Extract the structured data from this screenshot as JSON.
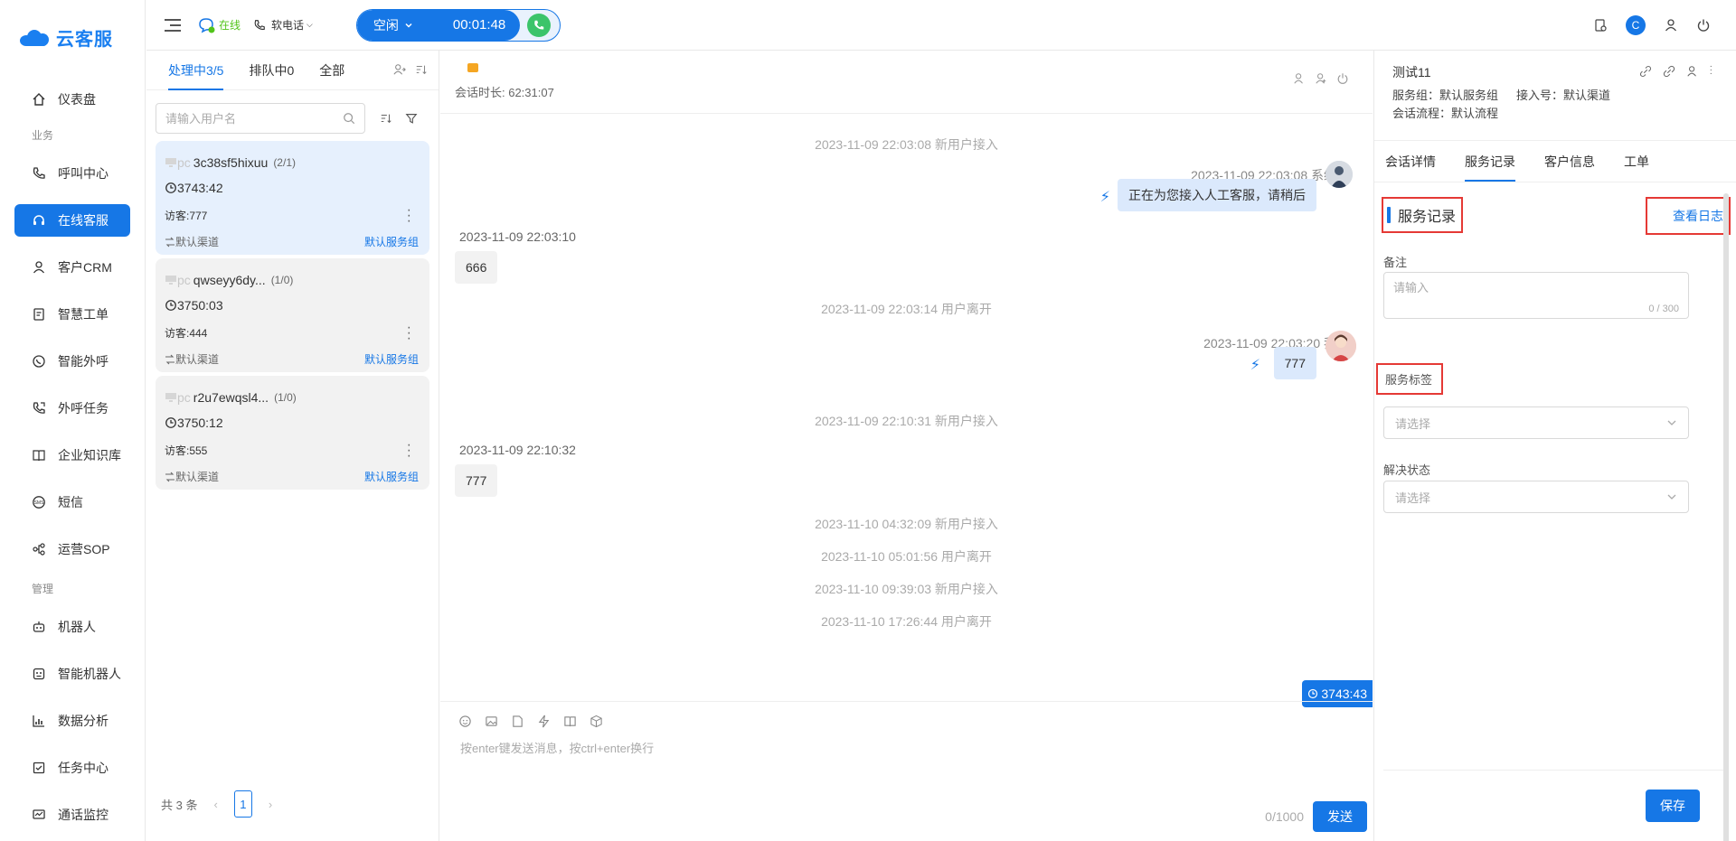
{
  "app": {
    "logo_text": "云客服",
    "brand_color": "#1677e6"
  },
  "sidebar": {
    "items": [
      {
        "label": "仪表盘",
        "icon": "home-icon"
      },
      {
        "group": "业务"
      },
      {
        "label": "呼叫中心",
        "icon": "phone-icon"
      },
      {
        "label": "在线客服",
        "icon": "headset-icon",
        "active": true
      },
      {
        "label": "客户CRM",
        "icon": "user-icon"
      },
      {
        "label": "智慧工单",
        "icon": "ticket-icon"
      },
      {
        "label": "智能外呼",
        "icon": "whatsapp-icon"
      },
      {
        "label": "外呼任务",
        "icon": "outbound-icon"
      },
      {
        "label": "企业知识库",
        "icon": "book-icon"
      },
      {
        "label": "短信",
        "icon": "sms-icon"
      },
      {
        "label": "运营SOP",
        "icon": "flow-icon"
      },
      {
        "group": "管理"
      },
      {
        "label": "机器人",
        "icon": "robot-icon"
      },
      {
        "label": "智能机器人",
        "icon": "smart-robot-icon"
      },
      {
        "label": "数据分析",
        "icon": "chart-icon"
      },
      {
        "label": "任务中心",
        "icon": "task-icon"
      },
      {
        "label": "通话监控",
        "icon": "monitor-icon"
      }
    ]
  },
  "topbar": {
    "online_label": "在线",
    "phone_label": "软电话",
    "call_state": "空闲",
    "call_timer": "00:01:48",
    "user_initial": "C"
  },
  "conversations": {
    "tabs": [
      "处理中3/5",
      "排队中0",
      "全部"
    ],
    "search_placeholder": "请输入用户名",
    "items": [
      {
        "device": "pc",
        "name": "3c38sf5hixuu",
        "count": "(2/1)",
        "time": "3743:42",
        "visitor": "访客:777",
        "channel": "默认渠道",
        "group": "默认服务组",
        "active": true
      },
      {
        "device": "pc",
        "name": "qwseyy6dy...",
        "count": "(1/0)",
        "time": "3750:03",
        "visitor": "访客:444",
        "channel": "默认渠道",
        "group": "默认服务组"
      },
      {
        "device": "pc",
        "name": "r2u7ewqsl4...",
        "count": "(1/0)",
        "time": "3750:12",
        "visitor": "访客:555",
        "channel": "默认渠道",
        "group": "默认服务组"
      }
    ],
    "total": "共 3 条",
    "page": "1"
  },
  "chat": {
    "duration": "会话时长: 62:31:07",
    "messages": {
      "sys1": "2023-11-09 22:03:08 新用户接入",
      "bot_meta": "2023-11-09 22:03:08 系统",
      "bot_text": "正在为您接入人工客服，请稍后",
      "user1_meta": "2023-11-09 22:03:10",
      "user1_text": "666",
      "sys2": "2023-11-09 22:03:14 用户离开",
      "me_meta": "2023-11-09 22:03:20 我",
      "me_text": "777",
      "sys3": "2023-11-09 22:10:31 新用户接入",
      "user2_meta": "2023-11-09 22:10:32",
      "user2_text": "777",
      "sys4": "2023-11-10 04:32:09 新用户接入",
      "sys5": "2023-11-10 05:01:56 用户离开",
      "sys6": "2023-11-10 09:39:03 新用户接入",
      "sys7": "2023-11-10 17:26:44 用户离开"
    },
    "timer_chip": "3743:43",
    "input_placeholder": "按enter键发送消息，按ctrl+enter换行",
    "char_count": "0/1000",
    "send_label": "发送"
  },
  "right_panel": {
    "title": "测试11",
    "service_group": "服务组：默认服务组",
    "access_no": "接入号：默认渠道",
    "flow": "会话流程：默认流程",
    "tabs": [
      "会话详情",
      "服务记录",
      "客户信息",
      "工单"
    ],
    "section_title": "服务记录",
    "view_log": "查看日志",
    "remark_label": "备注",
    "remark_placeholder": "请输入",
    "remark_count": "0 / 300",
    "tag_label": "服务标签",
    "tag_placeholder": "请选择",
    "status_label": "解决状态",
    "status_placeholder": "请选择",
    "save_label": "保存"
  }
}
